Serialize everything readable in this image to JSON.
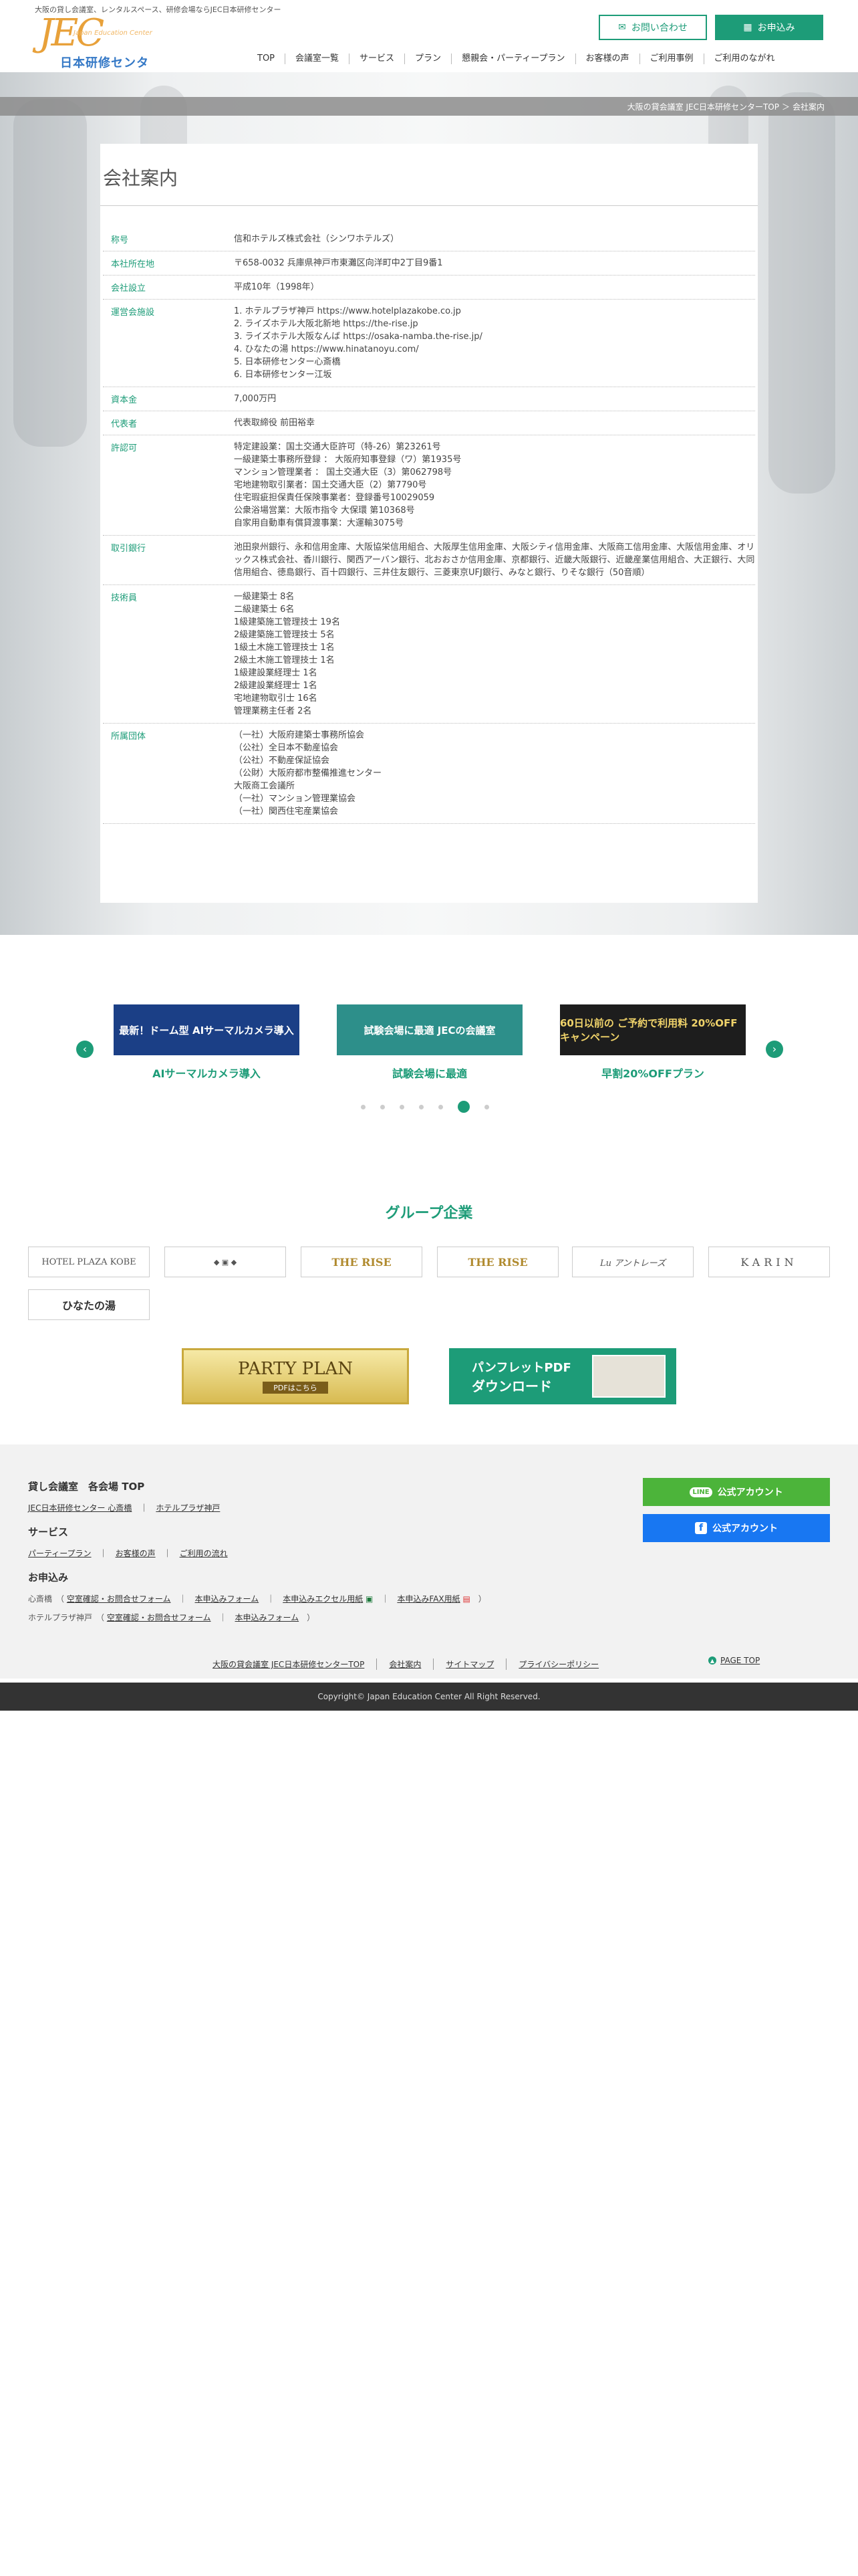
{
  "header": {
    "tagline": "大阪の貸し会議室、レンタルスペース、研修会場ならJEC日本研修センター",
    "logo_text": "JEC",
    "logo_sub": "Japan Education Center",
    "logo_ja": "日本研修センター",
    "contact_label": "お問い合わせ",
    "apply_label": "お申込み",
    "nav": [
      "TOP",
      "会議室一覧",
      "サービス",
      "プラン",
      "懇親会・パーティープラン",
      "お客様の声",
      "ご利用事例",
      "ご利用のながれ"
    ]
  },
  "breadcrumb": [
    "大阪の貸会議室 JEC日本研修センターTOP",
    "＞",
    "会社案内"
  ],
  "page_title": "会社案内",
  "company_table": [
    {
      "key": "称号",
      "lines": [
        "信和ホテルズ株式会社（シンワホテルズ）"
      ]
    },
    {
      "key": "本社所在地",
      "lines": [
        "〒658-0032 兵庫県神戸市東灘区向洋町中2丁目9番1"
      ]
    },
    {
      "key": "会社設立",
      "lines": [
        "平成10年（1998年）"
      ]
    },
    {
      "key": "運営会施設",
      "lines": [
        "1. ホテルプラザ神戸 https://www.hotelplazakobe.co.jp",
        "2. ライズホテル大阪北新地 https://the-rise.jp",
        "3. ライズホテル大阪なんば https://osaka-namba.the-rise.jp/",
        "4. ひなたの湯 https://www.hinatanoyu.com/",
        "5. 日本研修センター心斎橋",
        "6. 日本研修センター江坂"
      ]
    },
    {
      "key": "資本金",
      "lines": [
        "7,000万円"
      ]
    },
    {
      "key": "代表者",
      "lines": [
        "代表取締役 前田裕幸"
      ]
    },
    {
      "key": "許認可",
      "lines": [
        "特定建設業：国土交通大臣許可（特-26）第23261号",
        "一級建築士事務所登録 ： 大阪府知事登録（ワ）第1935号",
        "マンション管理業者 ： 国土交通大臣（3）第062798号",
        "宅地建物取引業者：国土交通大臣（2）第7790号",
        "住宅瑕疵担保責任保険事業者：登録番号10029059",
        "公衆浴場営業：大阪市指令 大保環 第10368号",
        "自家用自動車有償貸渡事業：大運輸3075号"
      ]
    },
    {
      "key": "取引銀行",
      "wrap": true,
      "lines": [
        "池田泉州銀行、永和信用金庫、大阪協栄信用組合、大阪厚生信用金庫、大阪シティ信用金庫、大阪商工信用金庫、大阪信用金庫、オリックス株式会社、香川銀行、関西アーバン銀行、北おおさか信用金庫、京都銀行、近畿大阪銀行、近畿産業信用組合、大正銀行、大同信用組合、徳島銀行、百十四銀行、三井住友銀行、三菱東京UFJ銀行、みなと銀行、りそな銀行（50音順）"
      ]
    },
    {
      "key": "技術員",
      "lines": [
        "一級建築士 8名",
        "二級建築士 6名",
        "1級建築施工管理技士 19名",
        "2級建築施工管理技士 5名",
        "1級土木施工管理技士 1名",
        "2級土木施工管理技士 1名",
        "1級建設業経理士 1名",
        "2級建設業経理士 1名",
        "宅地建物取引士 16名",
        "管理業務主任者 2名"
      ]
    },
    {
      "key": "所属団体",
      "lines": [
        "（一社）大阪府建築士事務所協会",
        "（公社）全日本不動産協会",
        "（公社）不動産保証協会",
        "（公財）大阪府都市整備推進センター",
        "大阪商工会議所",
        "（一社）マンション管理業協会",
        "（一社）関西住宅産業協会"
      ]
    }
  ],
  "carousel": {
    "slides": [
      {
        "banner": "最新！ドーム型 AIサーマルカメラ導入",
        "caption": "AIサーマルカメラ導入",
        "color": "#1b3f86"
      },
      {
        "banner": "試験会場に最適 JECの会議室",
        "caption": "試験会場に最適",
        "color": "#2d8f8a"
      },
      {
        "banner": "60日以前の ご予約で利用料 20%OFF キャンペーン",
        "caption": "早割20%OFFプラン",
        "color": "#1d1d1d"
      }
    ],
    "dot_count": 7,
    "active_dot": 5,
    "prev": "‹",
    "next": "›"
  },
  "group": {
    "title": "グループ企業",
    "logos": [
      "HOTEL PLAZA KOBE",
      "",
      "THE RISE",
      "THE RISE",
      "Lu アントレーズ",
      "KARIN",
      "ひなたの湯"
    ],
    "party_banner": {
      "main": "PARTY PLAN",
      "sub": "PDFはこちら"
    },
    "pamphlet_banner": {
      "main": "パンフレットPDF",
      "sub": "ダウンロード"
    }
  },
  "footer": {
    "sec1_title": "貸し会議室　各会場 TOP",
    "sec1_links": [
      "JEC日本研修センター 心斎橋",
      "ホテルプラザ神戸"
    ],
    "sec2_title": "サービス",
    "sec2_links": [
      "パーティープラン",
      "お客様の声",
      "ご利用の流れ"
    ],
    "sec3_title": "お申込み",
    "shinsaibashi_label": "心斎橋",
    "shinsaibashi_links": [
      "空室確認・お問合せフォーム",
      "本申込みフォーム",
      "本申込みエクセル用紙",
      "本申込みFAX用紙"
    ],
    "kobe_label": "ホテルプラザ神戸",
    "kobe_links": [
      "空室確認・お問合せフォーム",
      "本申込みフォーム"
    ],
    "line_label": "公式アカウント",
    "facebook_label": "公式アカウント",
    "bottom_links": [
      "大阪の貸会議室 JEC日本研修センターTOP",
      "会社案内",
      "サイトマップ",
      "プライバシーポリシー"
    ],
    "pagetop": "PAGE TOP",
    "copyright": "Copyright© Japan Education Center All Right Reserved."
  },
  "colors": {
    "accent": "#1d9c78",
    "logo_orange": "#e8a13a",
    "logo_blue": "#3478c6",
    "line_green": "#4cb43a",
    "facebook_blue": "#1877f2"
  }
}
